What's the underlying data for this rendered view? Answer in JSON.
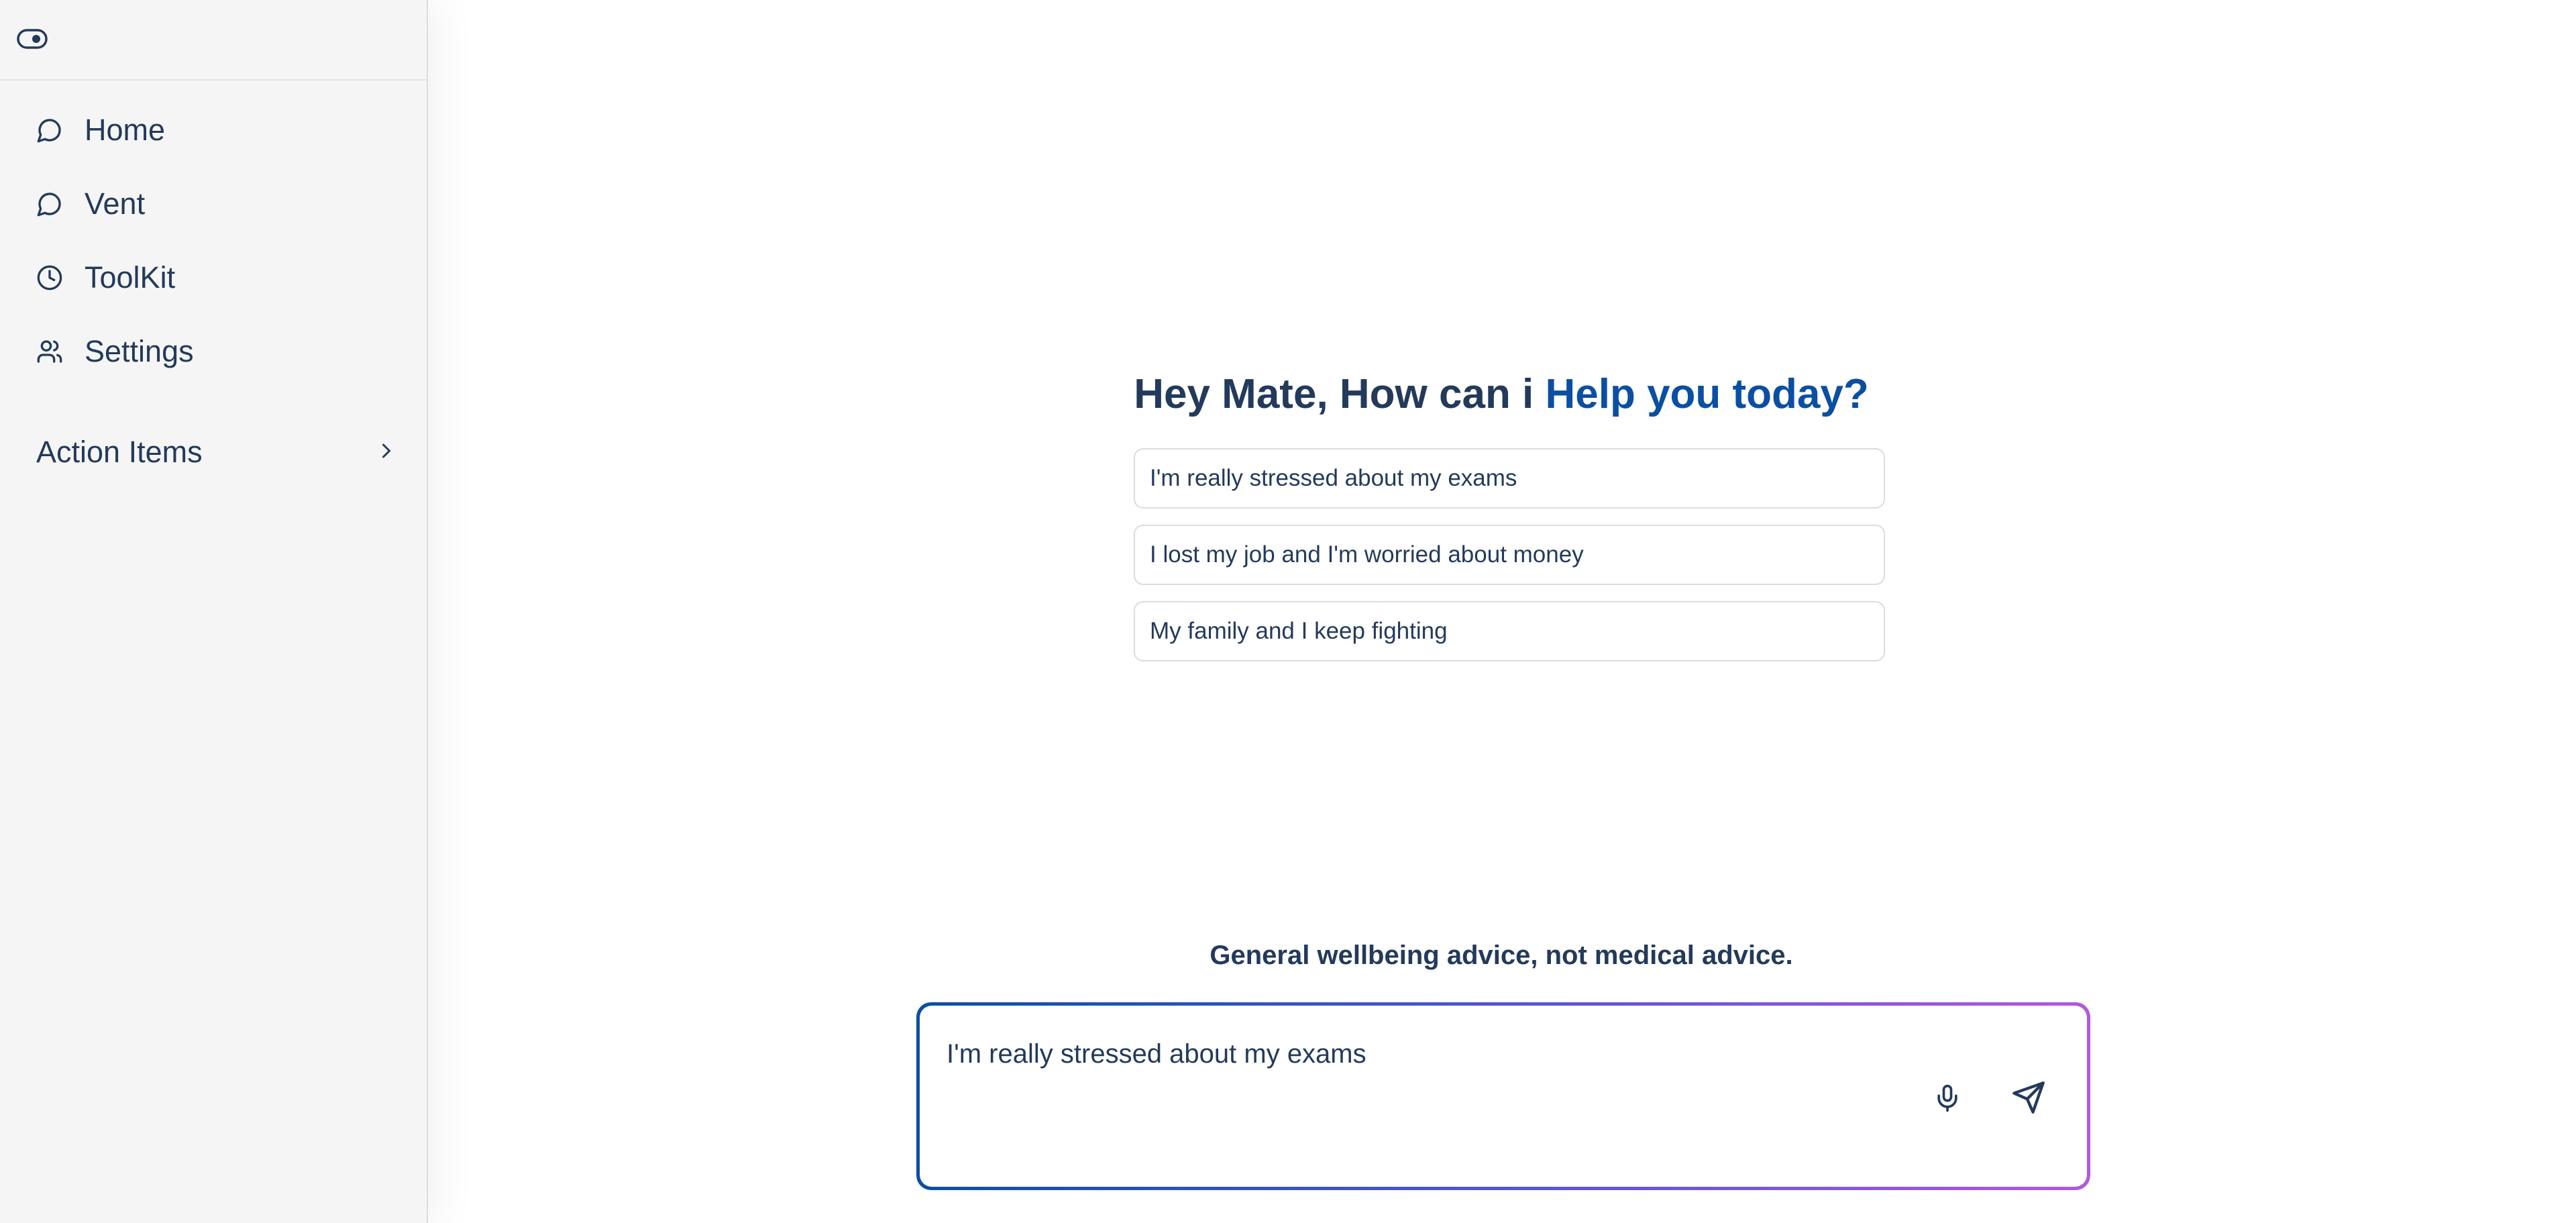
{
  "sidebar": {
    "toggle_icon": "eye-toggle-icon",
    "items": [
      {
        "label": "Home",
        "icon": "chat-bubble-icon"
      },
      {
        "label": "Vent",
        "icon": "chat-bubble-icon"
      },
      {
        "label": "ToolKit",
        "icon": "clock-icon"
      },
      {
        "label": "Settings",
        "icon": "users-icon"
      }
    ],
    "action_items": {
      "label": "Action Items",
      "icon": "chevron-right-icon"
    }
  },
  "main": {
    "greeting_prefix": "Hey Mate, How can i ",
    "greeting_accent": "Help you today?",
    "suggestions": [
      "I'm really stressed about my exams",
      "I lost my job and I'm worried about money",
      "My family and I keep fighting"
    ],
    "disclaimer": "General wellbeing advice, not medical advice.",
    "input": {
      "value": "I'm really stressed about my exams",
      "placeholder": ""
    },
    "mic_icon": "microphone-icon",
    "send_icon": "send-icon"
  },
  "colors": {
    "text": "#233a5b",
    "accent": "#0b4fa3",
    "sidebar_bg": "#f5f5f5",
    "gradient_start": "#0b4fa3",
    "gradient_end": "#b457e0"
  }
}
